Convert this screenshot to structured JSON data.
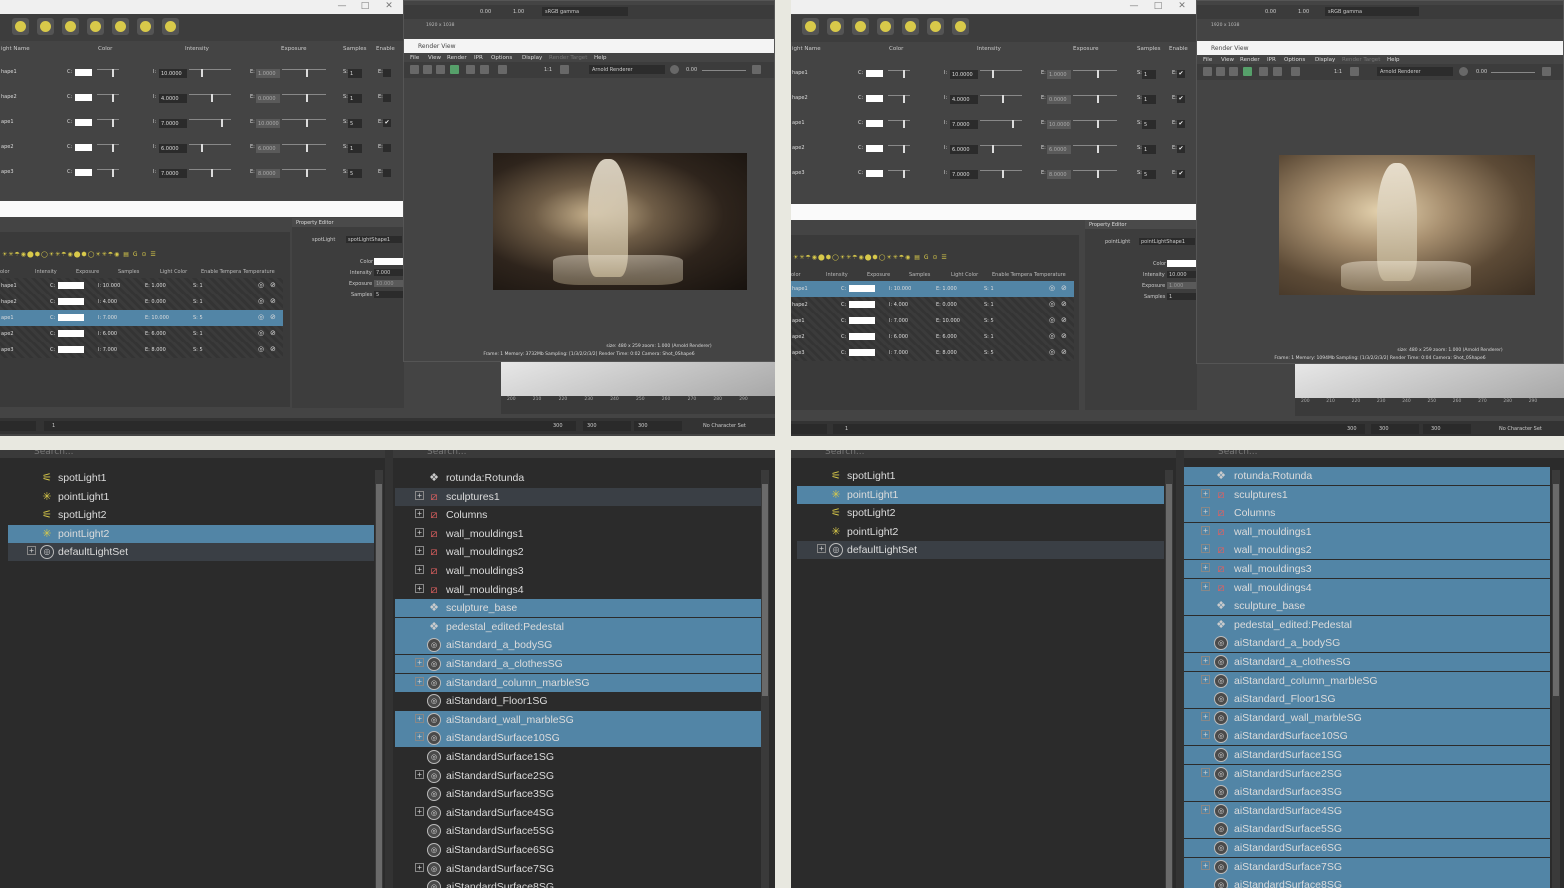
{
  "top_left": {
    "light_editor": {
      "headers": [
        "ight Name",
        "Color",
        "Intensity",
        "Exposure",
        "Samples",
        "Enable"
      ],
      "rows": [
        {
          "name": "hape1",
          "c": "C:",
          "i": "I:",
          "intensity": "10.0000",
          "e": "E:",
          "exposure": "1.0000",
          "s": "S:",
          "samples": "1",
          "en": "E:",
          "enabled": ""
        },
        {
          "name": "hape2",
          "c": "C:",
          "i": "I:",
          "intensity": "4.0000",
          "e": "E:",
          "exposure": "0.0000",
          "s": "S:",
          "samples": "1",
          "en": "E:",
          "enabled": ""
        },
        {
          "name": "ape1",
          "c": "C:",
          "i": "I:",
          "intensity": "7.0000",
          "e": "E:",
          "exposure": "10.0000",
          "s": "S:",
          "samples": "5",
          "en": "E:",
          "enabled": "✔"
        },
        {
          "name": "ape2",
          "c": "C:",
          "i": "I:",
          "intensity": "6.0000",
          "e": "E:",
          "exposure": "6.0000",
          "s": "S:",
          "samples": "1",
          "en": "E:",
          "enabled": ""
        },
        {
          "name": "ape3",
          "c": "C:",
          "i": "I:",
          "intensity": "7.0000",
          "e": "E:",
          "exposure": "8.0000",
          "s": "S:",
          "samples": "5",
          "en": "E:",
          "enabled": ""
        }
      ]
    },
    "light_list": {
      "headers": [
        "olor",
        "Intensity",
        "Exposure",
        "Samples",
        "Light Color",
        "Enable Tempera",
        "Temperature"
      ],
      "rows": [
        {
          "name": "hape1",
          "c": "C:",
          "intensity": "I: 10.000",
          "exposure": "E: 1.000",
          "samples": "S: 1"
        },
        {
          "name": "hape2",
          "c": "C:",
          "intensity": "I: 4.000",
          "exposure": "E: 0.000",
          "samples": "S: 1"
        },
        {
          "name": "ape1",
          "c": "C:",
          "intensity": "I: 7.000",
          "exposure": "E: 10.000",
          "samples": "S: 5"
        },
        {
          "name": "ape2",
          "c": "C:",
          "intensity": "I: 6.000",
          "exposure": "E: 6.000",
          "samples": "S: 1"
        },
        {
          "name": "ape3",
          "c": "C:",
          "intensity": "I: 7.000",
          "exposure": "E: 8.000",
          "samples": "S: 5"
        }
      ]
    },
    "property_editor": {
      "title": "Property Editor",
      "type": "spotLight",
      "node": "spotLightShape1",
      "color_label": "Color",
      "intensity_label": "Intensity",
      "intensity": "7.000",
      "exposure_label": "Exposure",
      "exposure": "10.000",
      "samples_label": "Samples",
      "samples": "5"
    },
    "render_view": {
      "resolution": "1920 x 1038",
      "gamma": "sRGB gamma",
      "val1": "0.00",
      "val2": "1.00",
      "title": "Render View",
      "menu": [
        "File",
        "View",
        "Render",
        "IPR",
        "Options",
        "Display",
        "Render Target",
        "Help"
      ],
      "renderer": "Arnold Renderer",
      "ratio": "1:1",
      "exposure": "0.00",
      "info_line": "size: 480 x 259  zoom: 1.000     (Arnold Renderer)",
      "stats_line": "Frame: 1    Memory: 3732Mb    Sampling: [1/3/2/2/3/2]    Render Time: 0:02    Camera: Shot_0Shape6"
    },
    "timeline_ticks": [
      "200",
      "210",
      "220",
      "230",
      "240",
      "250",
      "260",
      "270",
      "280",
      "290"
    ],
    "bottom": {
      "frame": "1",
      "end": "300",
      "f1": "300",
      "f2": "300",
      "charset": "No Character Set"
    }
  },
  "top_right": {
    "light_editor": {
      "headers": [
        "ight Name",
        "Color",
        "Intensity",
        "Exposure",
        "Samples",
        "Enable"
      ],
      "rows": [
        {
          "name": "hape1",
          "c": "C:",
          "i": "I:",
          "intensity": "10.0000",
          "e": "E:",
          "exposure": "1.0000",
          "s": "S:",
          "samples": "1",
          "en": "E:",
          "enabled": "✔"
        },
        {
          "name": "hape2",
          "c": "C:",
          "i": "I:",
          "intensity": "4.0000",
          "e": "E:",
          "exposure": "0.0000",
          "s": "S:",
          "samples": "1",
          "en": "E:",
          "enabled": "✔"
        },
        {
          "name": "ape1",
          "c": "C:",
          "i": "I:",
          "intensity": "7.0000",
          "e": "E:",
          "exposure": "10.0000",
          "s": "S:",
          "samples": "5",
          "en": "E:",
          "enabled": "✔"
        },
        {
          "name": "ape2",
          "c": "C:",
          "i": "I:",
          "intensity": "6.0000",
          "e": "E:",
          "exposure": "6.0000",
          "s": "S:",
          "samples": "1",
          "en": "E:",
          "enabled": "✔"
        },
        {
          "name": "ape3",
          "c": "C:",
          "i": "I:",
          "intensity": "7.0000",
          "e": "E:",
          "exposure": "8.0000",
          "s": "S:",
          "samples": "5",
          "en": "E:",
          "enabled": "✔"
        }
      ]
    },
    "light_list": {
      "headers": [
        "olor",
        "Intensity",
        "Exposure",
        "Samples",
        "Light Color",
        "Enable Tempera",
        "Temperature"
      ],
      "rows": [
        {
          "name": "hape1",
          "c": "C:",
          "intensity": "I: 10.000",
          "exposure": "E: 1.000",
          "samples": "S: 1"
        },
        {
          "name": "hape2",
          "c": "C:",
          "intensity": "I: 4.000",
          "exposure": "E: 0.000",
          "samples": "S: 1"
        },
        {
          "name": "ape1",
          "c": "C:",
          "intensity": "I: 7.000",
          "exposure": "E: 10.000",
          "samples": "S: 5"
        },
        {
          "name": "ape2",
          "c": "C:",
          "intensity": "I: 6.000",
          "exposure": "E: 6.000",
          "samples": "S: 1"
        },
        {
          "name": "ape3",
          "c": "C:",
          "intensity": "I: 7.000",
          "exposure": "E: 8.000",
          "samples": "S: 5"
        }
      ]
    },
    "property_editor": {
      "title": "Property Editor",
      "type": "pointLight",
      "node": "pointLightShape1",
      "color_label": "Color",
      "intensity_label": "Intensity",
      "intensity": "10.000",
      "exposure_label": "Exposure",
      "exposure": "1.000",
      "samples_label": "Samples",
      "samples": "1"
    },
    "render_view": {
      "resolution": "1920 x 1038",
      "gamma": "sRGB gamma",
      "val1": "0.00",
      "val2": "1.00",
      "title": "Render View",
      "menu": [
        "File",
        "View",
        "Render",
        "IPR",
        "Options",
        "Display",
        "Render Target",
        "Help"
      ],
      "renderer": "Arnold Renderer",
      "ratio": "1:1",
      "exposure": "0.00",
      "info_line": "size: 480 x 259  zoom: 1.000     (Arnold Renderer)",
      "stats_line": "Frame: 1    Memory: 1094Mb    Sampling: [1/3/2/2/3/2]    Render Time: 0:04    Camera: Shot_0Shape6"
    },
    "timeline_ticks": [
      "200",
      "210",
      "220",
      "230",
      "240",
      "250",
      "260",
      "270",
      "280",
      "290"
    ],
    "bottom": {
      "frame": "1",
      "end": "300",
      "f1": "300",
      "f2": "300",
      "charset": "No Character Set"
    }
  },
  "bottom_left": {
    "search_placeholder": "Search...",
    "lights": [
      {
        "label": "spotLight1",
        "icon": "spot"
      },
      {
        "label": "pointLight1",
        "icon": "point"
      },
      {
        "label": "spotLight2",
        "icon": "spot"
      },
      {
        "label": "pointLight2",
        "icon": "point",
        "selected": true
      },
      {
        "label": "defaultLightSet",
        "icon": "set",
        "expand": "+",
        "dim": true
      }
    ],
    "sets": [
      {
        "label": "rotunda:Rotunda",
        "icon": "dag"
      },
      {
        "label": "sculptures1",
        "icon": "mesh",
        "expand": "+",
        "dim": true
      },
      {
        "label": "Columns",
        "icon": "mesh",
        "expand": "+"
      },
      {
        "label": "wall_mouldings1",
        "icon": "mesh",
        "expand": "+"
      },
      {
        "label": "wall_mouldings2",
        "icon": "mesh",
        "expand": "+"
      },
      {
        "label": "wall_mouldings3",
        "icon": "mesh",
        "expand": "+"
      },
      {
        "label": "wall_mouldings4",
        "icon": "mesh",
        "expand": "+"
      },
      {
        "label": "sculpture_base",
        "icon": "dag",
        "selected": true
      },
      {
        "label": "pedestal_edited:Pedestal",
        "icon": "dag",
        "selected": true
      },
      {
        "label": "aiStandard_a_bodySG",
        "icon": "sg",
        "selected": true
      },
      {
        "label": "aiStandard_a_clothesSG",
        "icon": "sg",
        "expand": "+",
        "selected": true
      },
      {
        "label": "aiStandard_column_marbleSG",
        "icon": "sg",
        "expand": "+",
        "selected": true
      },
      {
        "label": "aiStandard_Floor1SG",
        "icon": "sg"
      },
      {
        "label": "aiStandard_wall_marbleSG",
        "icon": "sg",
        "expand": "+",
        "selected": true
      },
      {
        "label": "aiStandardSurface10SG",
        "icon": "sg",
        "expand": "+",
        "selected": true
      },
      {
        "label": "aiStandardSurface1SG",
        "icon": "sg"
      },
      {
        "label": "aiStandardSurface2SG",
        "icon": "sg",
        "expand": "+"
      },
      {
        "label": "aiStandardSurface3SG",
        "icon": "sg"
      },
      {
        "label": "aiStandardSurface4SG",
        "icon": "sg",
        "expand": "+"
      },
      {
        "label": "aiStandardSurface5SG",
        "icon": "sg"
      },
      {
        "label": "aiStandardSurface6SG",
        "icon": "sg"
      },
      {
        "label": "aiStandardSurface7SG",
        "icon": "sg",
        "expand": "+"
      },
      {
        "label": "aiStandardSurface8SG",
        "icon": "sg"
      }
    ]
  },
  "bottom_right": {
    "search_placeholder": "Search...",
    "lights": [
      {
        "label": "spotLight1",
        "icon": "spot"
      },
      {
        "label": "pointLight1",
        "icon": "point",
        "selected": true
      },
      {
        "label": "spotLight2",
        "icon": "spot"
      },
      {
        "label": "pointLight2",
        "icon": "point"
      },
      {
        "label": "defaultLightSet",
        "icon": "set",
        "expand": "+",
        "dim": true
      }
    ],
    "sets": [
      {
        "label": "rotunda:Rotunda",
        "icon": "dag",
        "selected": true
      },
      {
        "label": "sculptures1",
        "icon": "mesh",
        "expand": "+",
        "selected": true
      },
      {
        "label": "Columns",
        "icon": "mesh",
        "expand": "+",
        "selected": true
      },
      {
        "label": "wall_mouldings1",
        "icon": "mesh",
        "expand": "+",
        "selected": true
      },
      {
        "label": "wall_mouldings2",
        "icon": "mesh",
        "expand": "+",
        "selected": true
      },
      {
        "label": "wall_mouldings3",
        "icon": "mesh",
        "expand": "+",
        "selected": true
      },
      {
        "label": "wall_mouldings4",
        "icon": "mesh",
        "expand": "+",
        "selected": true
      },
      {
        "label": "sculpture_base",
        "icon": "dag",
        "selected": true
      },
      {
        "label": "pedestal_edited:Pedestal",
        "icon": "dag",
        "selected": true
      },
      {
        "label": "aiStandard_a_bodySG",
        "icon": "sg",
        "selected": true
      },
      {
        "label": "aiStandard_a_clothesSG",
        "icon": "sg",
        "expand": "+",
        "selected": true
      },
      {
        "label": "aiStandard_column_marbleSG",
        "icon": "sg",
        "expand": "+",
        "selected": true
      },
      {
        "label": "aiStandard_Floor1SG",
        "icon": "sg",
        "selected": true
      },
      {
        "label": "aiStandard_wall_marbleSG",
        "icon": "sg",
        "expand": "+",
        "selected": true
      },
      {
        "label": "aiStandardSurface10SG",
        "icon": "sg",
        "expand": "+",
        "selected": true
      },
      {
        "label": "aiStandardSurface1SG",
        "icon": "sg",
        "selected": true
      },
      {
        "label": "aiStandardSurface2SG",
        "icon": "sg",
        "expand": "+",
        "selected": true
      },
      {
        "label": "aiStandardSurface3SG",
        "icon": "sg",
        "selected": true
      },
      {
        "label": "aiStandardSurface4SG",
        "icon": "sg",
        "expand": "+",
        "selected": true
      },
      {
        "label": "aiStandardSurface5SG",
        "icon": "sg",
        "selected": true
      },
      {
        "label": "aiStandardSurface6SG",
        "icon": "sg",
        "selected": true
      },
      {
        "label": "aiStandardSurface7SG",
        "icon": "sg",
        "expand": "+",
        "selected": true
      },
      {
        "label": "aiStandardSurface8SG",
        "icon": "sg",
        "selected": true
      }
    ]
  },
  "colors": {
    "selection": "#5285a6",
    "panel": "#444444",
    "outliner_bg": "#2b2b2b",
    "light_icon": "#d8c94a"
  },
  "window_controls": {
    "minimize": "—",
    "maximize": "□",
    "close": "✕"
  }
}
